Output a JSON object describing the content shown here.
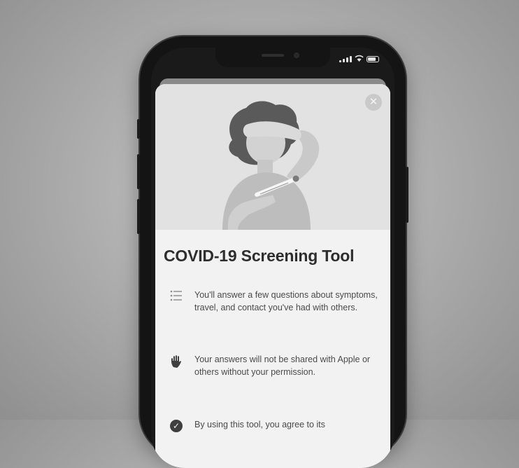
{
  "title": "COVID-19 Screening Tool",
  "info_rows": [
    {
      "icon": "list-icon",
      "text": "You'll answer a few questions about symptoms, travel, and contact you've had with others."
    },
    {
      "icon": "hand-icon",
      "text": "Your answers will not be shared with Apple or others without your permission."
    },
    {
      "icon": "checkmark-circle-icon",
      "text": "By using this tool, you agree to its"
    }
  ],
  "close_icon": "close-icon",
  "illustration": "person-with-thermometer-illustration",
  "status_icons": [
    "cellular-signal-icon",
    "wifi-icon",
    "battery-icon"
  ]
}
